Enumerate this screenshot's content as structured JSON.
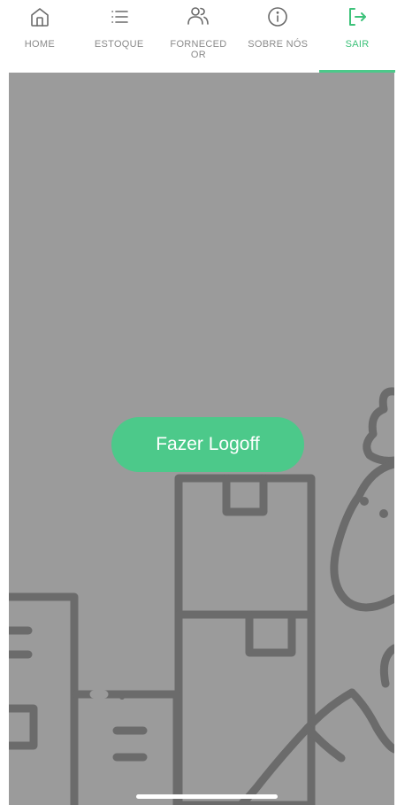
{
  "tabs": [
    {
      "id": "home",
      "label": "HOME",
      "icon": "home-icon"
    },
    {
      "id": "estoque",
      "label": "ESTOQUE",
      "icon": "list-icon"
    },
    {
      "id": "fornecedor",
      "label": "FORNECED OR",
      "icon": "users-icon"
    },
    {
      "id": "sobre",
      "label": "SOBRE NÓS",
      "icon": "info-icon"
    },
    {
      "id": "sair",
      "label": "SAIR",
      "icon": "logout-icon",
      "active": true
    }
  ],
  "main": {
    "logoff_label": "Fazer Logoff"
  },
  "colors": {
    "accent": "#4cc98a",
    "background": "#9b9b9b",
    "inactive_tab": "#8a8a8a",
    "illustration_stroke": "#6b6b6b"
  }
}
